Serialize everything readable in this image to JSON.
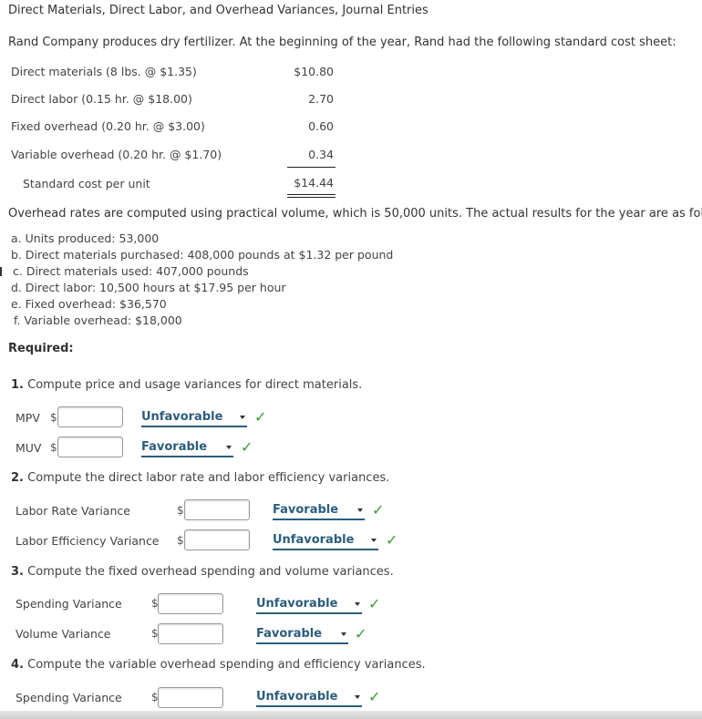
{
  "title": "Direct Materials, Direct Labor, and Overhead Variances, Journal Entries",
  "intro": "Rand Company produces dry fertilizer. At the beginning of the year, Rand had the following standard cost sheet:",
  "cost_sheet": {
    "rows": [
      {
        "label": "Direct materials (8 lbs. @ $1.35)",
        "value": "$10.80"
      },
      {
        "label": "Direct labor (0.15 hr. @ $18.00)",
        "value": "2.70"
      },
      {
        "label": "Fixed overhead (0.20 hr. @ $3.00)",
        "value": "0.60"
      },
      {
        "label": "Variable overhead (0.20 hr. @ $1.70)",
        "value": "0.34"
      }
    ],
    "total_label": "Standard cost per unit",
    "total_value": "$14.44"
  },
  "overhead_paragraph": "Overhead rates are computed using practical volume, which is 50,000 units. The actual results for the year are as follows:",
  "actual_results": [
    "a. Units produced: 53,000",
    "b. Direct materials purchased: 408,000 pounds at $1.32 per pound",
    "c. Direct materials used: 407,000 pounds",
    "d. Direct labor: 10,500 hours at $17.95 per hour",
    "e. Fixed overhead: $36,570",
    "f. Variable overhead: $18,000"
  ],
  "required_label": "Required:",
  "questions": [
    {
      "number": "1.",
      "text": " Compute price and usage variances for direct materials.",
      "rows": [
        {
          "label": "MPV",
          "currency": "$",
          "value": "",
          "selection": "Unfavorable",
          "status": "correct"
        },
        {
          "label": "MUV",
          "currency": "$",
          "value": "",
          "selection": "Favorable",
          "status": "correct"
        }
      ]
    },
    {
      "number": "2.",
      "text": " Compute the direct labor rate and labor efficiency variances.",
      "rows": [
        {
          "label": "Labor Rate Variance",
          "currency": "$",
          "value": "",
          "selection": "Favorable",
          "status": "correct"
        },
        {
          "label": "Labor Efficiency Variance",
          "currency": "$",
          "value": "",
          "selection": "Unfavorable",
          "status": "correct"
        }
      ]
    },
    {
      "number": "3.",
      "text": " Compute the fixed overhead spending and volume variances.",
      "rows": [
        {
          "label": "Spending Variance",
          "currency": "$",
          "value": "",
          "selection": "Unfavorable",
          "status": "correct"
        },
        {
          "label": "Volume Variance",
          "currency": "$",
          "value": "",
          "selection": "Favorable",
          "status": "correct"
        }
      ]
    },
    {
      "number": "4.",
      "text": " Compute the variable overhead spending and efficiency variances.",
      "rows": [
        {
          "label": "Spending Variance",
          "currency": "$",
          "value": "",
          "selection": "Unfavorable",
          "status": "correct"
        }
      ]
    }
  ],
  "icons": {
    "check": "✓"
  },
  "colors": {
    "dropdown_text": "#2b5d7e",
    "check": "#3a9a3a"
  }
}
